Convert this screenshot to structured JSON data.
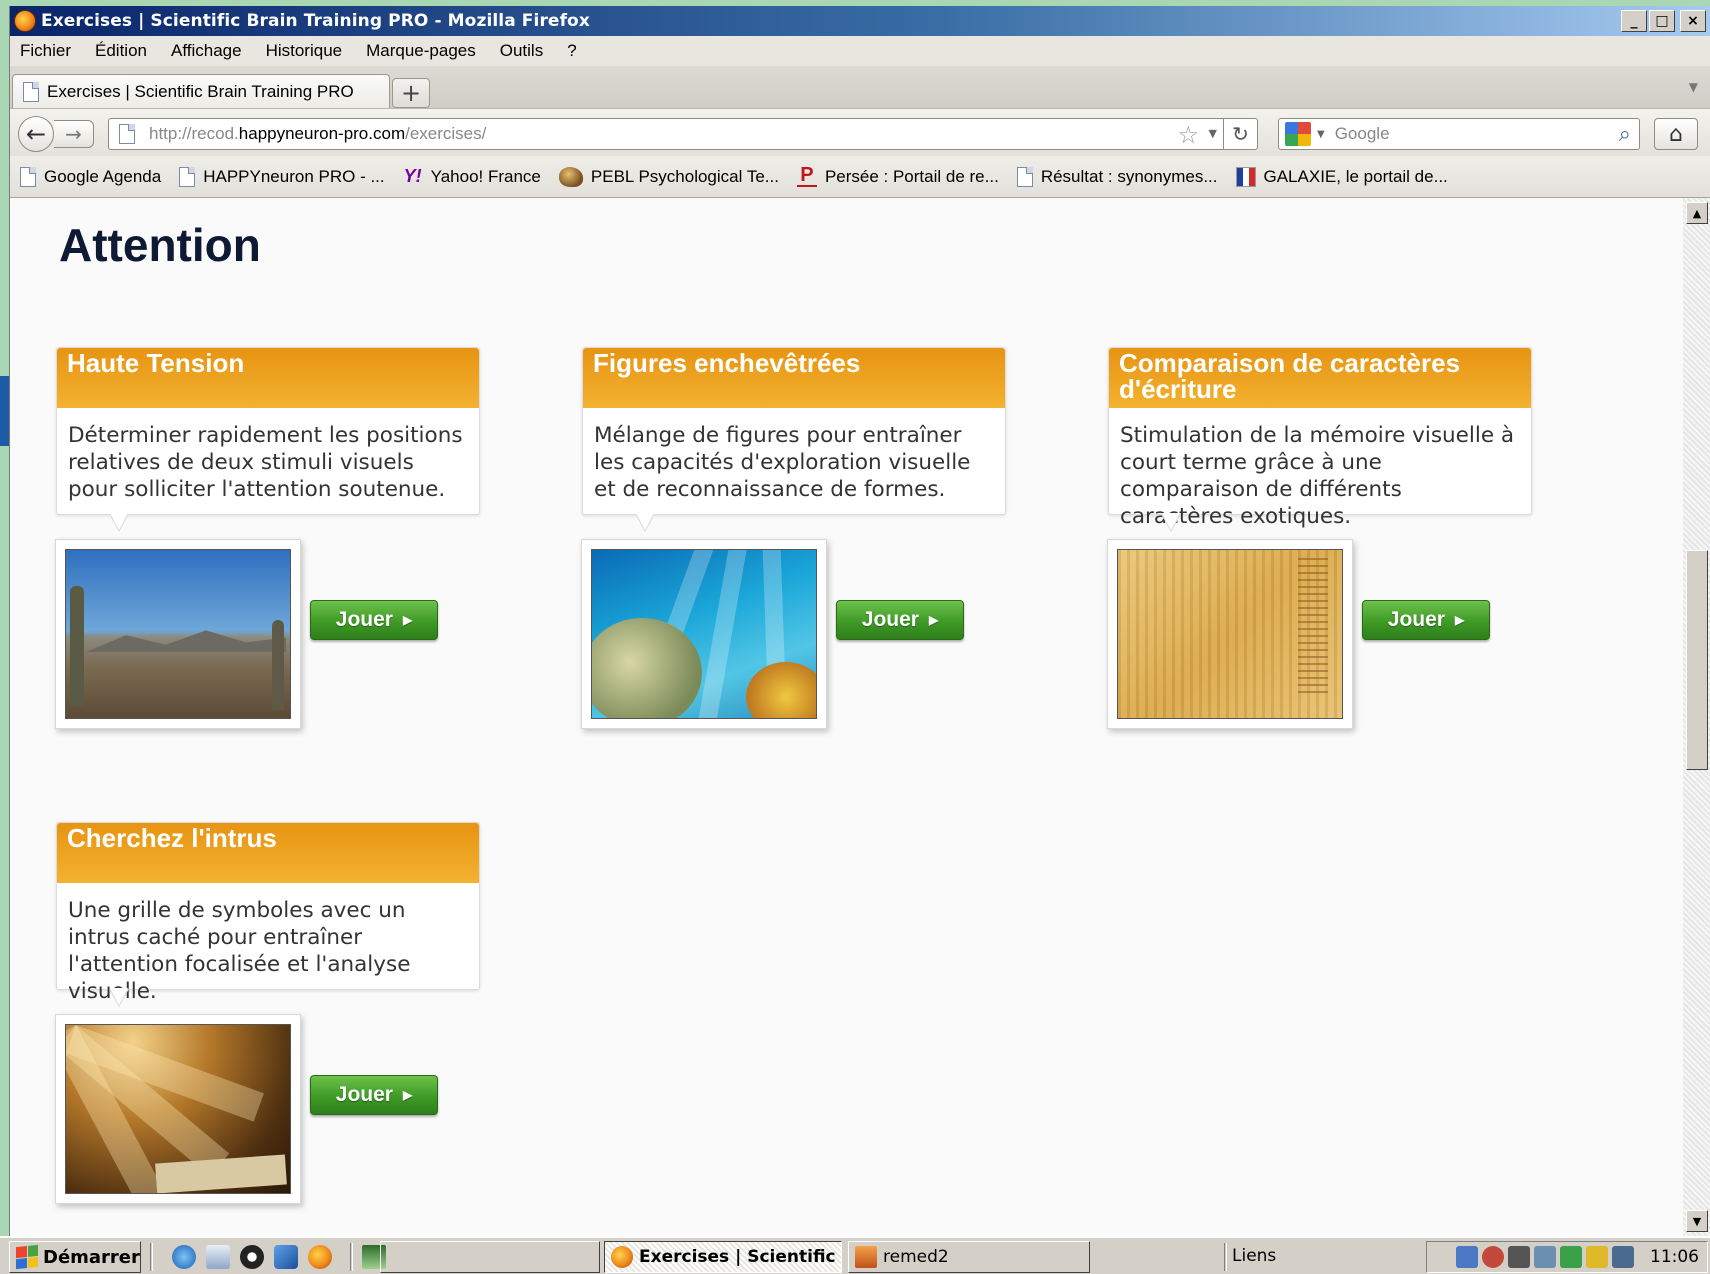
{
  "window": {
    "title": "Exercises | Scientific Brain Training PRO - Mozilla Firefox",
    "controls": {
      "minimize": "_",
      "maximize": "□",
      "close": "×"
    }
  },
  "menu": [
    {
      "label": "Fichier"
    },
    {
      "label": "Édition"
    },
    {
      "label": "Affichage"
    },
    {
      "label": "Historique"
    },
    {
      "label": "Marque-pages"
    },
    {
      "label": "Outils"
    },
    {
      "label": "?"
    }
  ],
  "tabs": [
    {
      "label": "Exercises | Scientific Brain Training PRO"
    }
  ],
  "newtab_label": "+",
  "nav": {
    "url_prefix": "http://recod.",
    "url_domain": "happyneuron-pro.com",
    "url_path": "/exercises/",
    "search_placeholder": "Google"
  },
  "bookmarks": [
    {
      "label": "Google Agenda",
      "icon": "doc-icon"
    },
    {
      "label": "HAPPYneuron PRO - ...",
      "icon": "doc-icon"
    },
    {
      "label": "Yahoo! France",
      "icon": "yahoo-icon",
      "glyph": "Y!"
    },
    {
      "label": "PEBL Psychological Te...",
      "icon": "pebl-icon"
    },
    {
      "label": "Persée : Portail de re...",
      "icon": "persee-icon",
      "glyph": "P"
    },
    {
      "label": "Résultat : synonymes...",
      "icon": "doc-icon"
    },
    {
      "label": "GALAXIE, le portail de...",
      "icon": "galaxie-icon"
    }
  ],
  "page": {
    "title": "Attention",
    "exercises": [
      {
        "title": "Haute Tension",
        "description": "Déterminer rapidement les positions relatives de deux stimuli visuels pour solliciter l'attention soutenue.",
        "play_label": "Jouer"
      },
      {
        "title": "Figures enchevêtrées",
        "description": "Mélange de figures pour entraîner les capacités d'exploration visuelle et de reconnaissance de formes.",
        "play_label": "Jouer"
      },
      {
        "title": "Comparaison de caractères d'écriture",
        "description": "Stimulation de la mémoire visuelle à court terme grâce à une comparaison de différents caractères exotiques.",
        "play_label": "Jouer"
      },
      {
        "title": "Cherchez l'intrus",
        "description": "Une grille de symboles avec un intrus caché pour entraîner l'attention focalisée et l'analyse visuelle.",
        "play_label": "Jouer"
      }
    ]
  },
  "taskbar": {
    "start_label": "Démarrer",
    "tasks": [
      {
        "label": "Exercises | Scientific ..."
      },
      {
        "label": "remed2"
      }
    ],
    "links_label": "Liens",
    "clock": "11:06"
  },
  "colors": {
    "accent_orange": "#e8960f",
    "play_green": "#3f9a26",
    "title_navy": "#0e1a33"
  }
}
